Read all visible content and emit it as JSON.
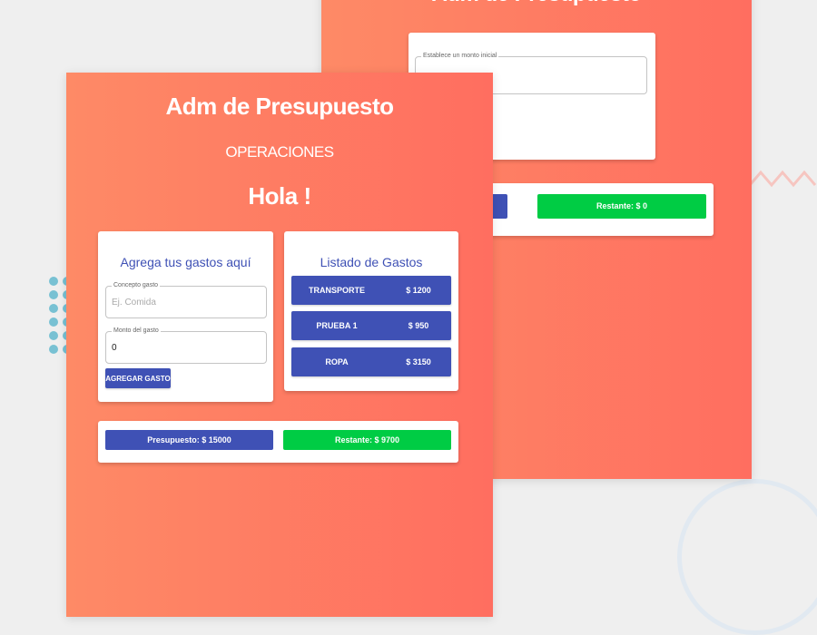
{
  "colors": {
    "primary": "#3f51b5",
    "success": "#00cc44",
    "gradient_start": "#fe8a66",
    "gradient_end": "#ff6e60",
    "deco_dots": "#78c1d3",
    "deco_zigzag": "#f6c5c0",
    "deco_circle": "#e1e9f1"
  },
  "back_panel": {
    "title": "Adm de Presupuesto",
    "initial_field_label": "Establece un monto inicial",
    "initial_field_value": "",
    "remaining_label": "Restante: $ 0"
  },
  "front_panel": {
    "title": "Adm de Presupuesto",
    "subtitle": "OPERACIONES",
    "greeting": "Hola !",
    "add_expense_card": {
      "title": "Agrega tus gastos aquí",
      "concept_label": "Concepto gasto",
      "concept_placeholder": "Ej. Comida",
      "concept_value": "",
      "amount_label": "Monto del gasto",
      "amount_value": "0",
      "submit_label": "AGREGAR GASTO"
    },
    "expenses_card": {
      "title": "Listado de Gastos",
      "items": [
        {
          "name": "TRANSPORTE",
          "amount": "$ 1200"
        },
        {
          "name": "PRUEBA 1",
          "amount": "$ 950"
        },
        {
          "name": "ROPA",
          "amount": "$ 3150"
        }
      ]
    },
    "summary": {
      "budget_label": "Presupuesto: $ 15000",
      "remaining_label": "Restante: $ 9700"
    }
  },
  "icons": [
    "dot-grid-decoration",
    "zigzag-decoration",
    "circle-outline-decoration"
  ]
}
